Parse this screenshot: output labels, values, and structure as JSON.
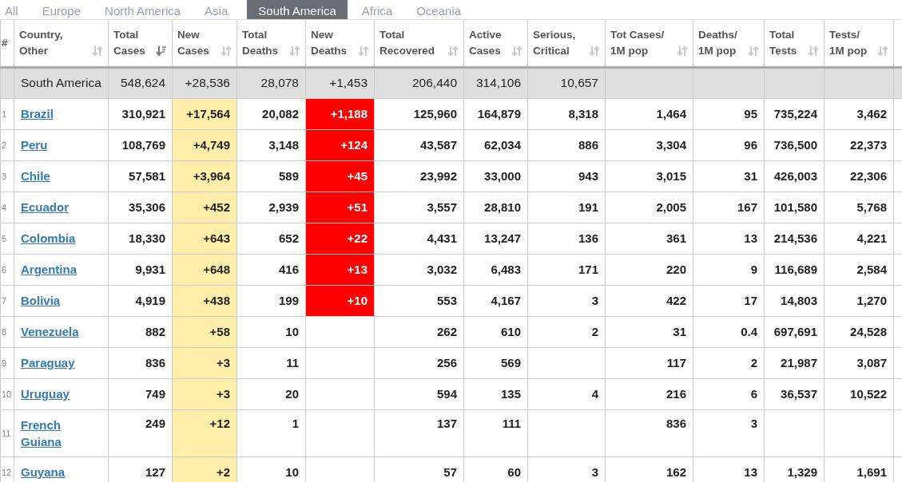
{
  "tabs": [
    {
      "label": "All",
      "selected": false
    },
    {
      "label": "Europe",
      "selected": false
    },
    {
      "label": "North America",
      "selected": false
    },
    {
      "label": "Asia",
      "selected": false
    },
    {
      "label": "South America",
      "selected": true
    },
    {
      "label": "Africa",
      "selected": false
    },
    {
      "label": "Oceania",
      "selected": false
    }
  ],
  "table": {
    "columns": [
      {
        "label": "#",
        "kind": "rank"
      },
      {
        "label": "Country,\nOther",
        "kind": "country",
        "sorted": false
      },
      {
        "label": "Total\nCases",
        "kind": "number",
        "sorted": true
      },
      {
        "label": "New\nCases",
        "kind": "new_cases",
        "sorted": false
      },
      {
        "label": "Total\nDeaths",
        "kind": "number",
        "sorted": false
      },
      {
        "label": "New\nDeaths",
        "kind": "new_deaths",
        "sorted": false
      },
      {
        "label": "Total\nRecovered",
        "kind": "number",
        "sorted": false
      },
      {
        "label": "Active\nCases",
        "kind": "number",
        "sorted": false
      },
      {
        "label": "Serious,\nCritical",
        "kind": "number",
        "sorted": false
      },
      {
        "label": "Tot Cases/\n1M pop",
        "kind": "number",
        "sorted": false
      },
      {
        "label": "Deaths/\n1M pop",
        "kind": "number",
        "sorted": false
      },
      {
        "label": "Total\nTests",
        "kind": "number",
        "sorted": false
      },
      {
        "label": "Tests/\n1M pop",
        "kind": "number",
        "sorted": false
      }
    ],
    "total_row": {
      "country": "South America",
      "total_cases": "548,624",
      "new_cases": "+28,536",
      "total_deaths": "28,078",
      "new_deaths": "+1,453",
      "total_recovered": "206,440",
      "active_cases": "314,106",
      "serious_critical": "10,657"
    },
    "rows": [
      {
        "rank": "1",
        "country": "Brazil",
        "total_cases": "310,921",
        "new_cases": "+17,564",
        "total_deaths": "20,082",
        "new_deaths": "+1,188",
        "total_recovered": "125,960",
        "active_cases": "164,879",
        "serious_critical": "8,318",
        "cases_per_1m": "1,464",
        "deaths_per_1m": "95",
        "total_tests": "735,224",
        "tests_per_1m": "3,462"
      },
      {
        "rank": "2",
        "country": "Peru",
        "total_cases": "108,769",
        "new_cases": "+4,749",
        "total_deaths": "3,148",
        "new_deaths": "+124",
        "total_recovered": "43,587",
        "active_cases": "62,034",
        "serious_critical": "886",
        "cases_per_1m": "3,304",
        "deaths_per_1m": "96",
        "total_tests": "736,500",
        "tests_per_1m": "22,373"
      },
      {
        "rank": "3",
        "country": "Chile",
        "total_cases": "57,581",
        "new_cases": "+3,964",
        "total_deaths": "589",
        "new_deaths": "+45",
        "total_recovered": "23,992",
        "active_cases": "33,000",
        "serious_critical": "943",
        "cases_per_1m": "3,015",
        "deaths_per_1m": "31",
        "total_tests": "426,003",
        "tests_per_1m": "22,306"
      },
      {
        "rank": "4",
        "country": "Ecuador",
        "total_cases": "35,306",
        "new_cases": "+452",
        "total_deaths": "2,939",
        "new_deaths": "+51",
        "total_recovered": "3,557",
        "active_cases": "28,810",
        "serious_critical": "191",
        "cases_per_1m": "2,005",
        "deaths_per_1m": "167",
        "total_tests": "101,580",
        "tests_per_1m": "5,768"
      },
      {
        "rank": "5",
        "country": "Colombia",
        "total_cases": "18,330",
        "new_cases": "+643",
        "total_deaths": "652",
        "new_deaths": "+22",
        "total_recovered": "4,431",
        "active_cases": "13,247",
        "serious_critical": "136",
        "cases_per_1m": "361",
        "deaths_per_1m": "13",
        "total_tests": "214,536",
        "tests_per_1m": "4,221"
      },
      {
        "rank": "6",
        "country": "Argentina",
        "total_cases": "9,931",
        "new_cases": "+648",
        "total_deaths": "416",
        "new_deaths": "+13",
        "total_recovered": "3,032",
        "active_cases": "6,483",
        "serious_critical": "171",
        "cases_per_1m": "220",
        "deaths_per_1m": "9",
        "total_tests": "116,689",
        "tests_per_1m": "2,584"
      },
      {
        "rank": "7",
        "country": "Bolivia",
        "total_cases": "4,919",
        "new_cases": "+438",
        "total_deaths": "199",
        "new_deaths": "+10",
        "total_recovered": "553",
        "active_cases": "4,167",
        "serious_critical": "3",
        "cases_per_1m": "422",
        "deaths_per_1m": "17",
        "total_tests": "14,803",
        "tests_per_1m": "1,270"
      },
      {
        "rank": "8",
        "country": "Venezuela",
        "total_cases": "882",
        "new_cases": "+58",
        "total_deaths": "10",
        "total_recovered": "262",
        "active_cases": "610",
        "serious_critical": "2",
        "cases_per_1m": "31",
        "deaths_per_1m": "0.4",
        "total_tests": "697,691",
        "tests_per_1m": "24,528"
      },
      {
        "rank": "9",
        "country": "Paraguay",
        "total_cases": "836",
        "new_cases": "+3",
        "total_deaths": "11",
        "total_recovered": "256",
        "active_cases": "569",
        "cases_per_1m": "117",
        "deaths_per_1m": "2",
        "total_tests": "21,987",
        "tests_per_1m": "3,087"
      },
      {
        "rank": "10",
        "country": "Uruguay",
        "total_cases": "749",
        "new_cases": "+3",
        "total_deaths": "20",
        "total_recovered": "594",
        "active_cases": "135",
        "serious_critical": "4",
        "cases_per_1m": "216",
        "deaths_per_1m": "6",
        "total_tests": "36,537",
        "tests_per_1m": "10,522"
      },
      {
        "rank": "11",
        "country": "French\nGuiana",
        "total_cases": "249",
        "new_cases": "+12",
        "total_deaths": "1",
        "total_recovered": "137",
        "active_cases": "111",
        "cases_per_1m": "836",
        "deaths_per_1m": "3"
      },
      {
        "rank": "12",
        "country": "Guyana",
        "total_cases": "127",
        "new_cases": "+2",
        "total_deaths": "10",
        "total_recovered": "57",
        "active_cases": "60",
        "serious_critical": "3",
        "cases_per_1m": "162",
        "deaths_per_1m": "13",
        "total_tests": "1,329",
        "tests_per_1m": "1,691"
      }
    ]
  }
}
